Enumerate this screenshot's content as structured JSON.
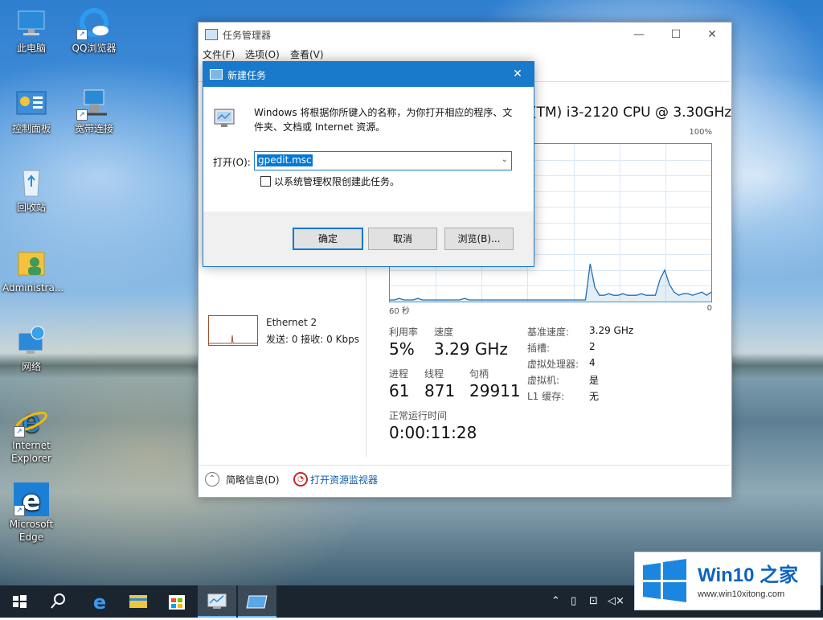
{
  "desktop": {
    "icons": [
      {
        "label": "此电脑",
        "icon": "computer-icon"
      },
      {
        "label": "QQ浏览器",
        "icon": "qq-browser-icon"
      },
      {
        "label": "控制面板",
        "icon": "control-panel-icon"
      },
      {
        "label": "宽带连接",
        "icon": "broadband-connection-icon"
      },
      {
        "label": "回收站",
        "icon": "recycle-bin-icon"
      },
      {
        "label": "Administra...",
        "icon": "user-folder-icon"
      },
      {
        "label": "网络",
        "icon": "network-icon"
      },
      {
        "label": "Internet Explorer",
        "icon": "internet-explorer-icon"
      },
      {
        "label": "Microsoft Edge",
        "icon": "edge-icon"
      }
    ]
  },
  "task_manager": {
    "title": "任务管理器",
    "menu": [
      "文件(F)",
      "选项(O)",
      "查看(V)"
    ],
    "controls": {
      "minimize": "—",
      "maximize": "☐",
      "close": "✕"
    },
    "cpu_name": "(TM) i3-2120 CPU @ 3.30GHz",
    "graph_max_label": "100%",
    "axis_left": "60 秒",
    "axis_right": "0",
    "ethernet": {
      "name": "Ethernet 2",
      "stats": "发送: 0  接收: 0 Kbps"
    },
    "stats": {
      "utilization_label": "利用率",
      "utilization_value": "5%",
      "speed_label": "速度",
      "speed_value": "3.29 GHz",
      "processes_label": "进程",
      "processes_value": "61",
      "threads_label": "线程",
      "threads_value": "871",
      "handles_label": "句柄",
      "handles_value": "29911",
      "uptime_label": "正常运行时间",
      "uptime_value": "0:00:11:28"
    },
    "details": [
      {
        "key": "基准速度:",
        "value": "3.29 GHz"
      },
      {
        "key": "插槽:",
        "value": "2"
      },
      {
        "key": "虚拟处理器:",
        "value": "4"
      },
      {
        "key": "虚拟机:",
        "value": "是"
      },
      {
        "key": "L1 缓存:",
        "value": "无"
      }
    ],
    "footer": {
      "fewer_details": "简略信息(D)",
      "open_resmon": "打开资源监视器"
    },
    "cpu_history_percent": [
      1,
      1,
      2,
      1,
      1,
      1,
      2,
      1,
      1,
      1,
      1,
      1,
      1,
      1,
      1,
      1,
      2,
      1,
      1,
      1,
      1,
      1,
      1,
      1,
      1,
      1,
      1,
      1,
      1,
      1,
      1,
      1,
      1,
      1,
      1,
      1,
      1,
      1,
      1,
      1,
      1,
      1,
      1,
      24,
      9,
      4,
      4,
      5,
      4,
      4,
      5,
      4,
      4,
      4,
      5,
      4,
      4,
      4,
      14,
      20,
      11,
      6,
      4,
      5,
      5,
      4,
      5,
      6,
      4,
      6
    ]
  },
  "run_dialog": {
    "title": "新建任务",
    "description": "Windows 将根据你所键入的名称，为你打开相应的程序、文件夹、文档或 Internet 资源。",
    "open_label": "打开(O):",
    "open_value": "gpedit.msc",
    "admin_checkbox_label": "以系统管理权限创建此任务。",
    "admin_checked": false,
    "ok_label": "确定",
    "cancel_label": "取消",
    "browse_label": "浏览(B)...",
    "close_glyph": "✕"
  },
  "taskbar": {
    "items": [
      "start-icon",
      "search-icon",
      "edge-icon",
      "file-explorer-icon",
      "store-icon",
      "task-manager-icon",
      "run-dialog-icon"
    ],
    "tray": [
      "chevron-up-icon",
      "tablet-icon",
      "network-icon",
      "volume-muted-icon"
    ],
    "accent": "#76b9ed"
  },
  "watermark": {
    "brand": "Win10",
    "brand_suffix": "之家",
    "url": "www.win10xitong.com",
    "color": "#0b64c0"
  }
}
